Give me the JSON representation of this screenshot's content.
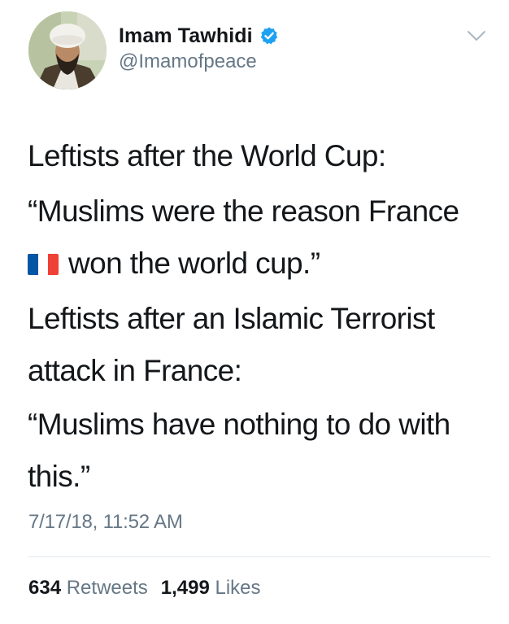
{
  "user": {
    "display_name": "Imam Tawhidi",
    "handle": "@Imamofpeace",
    "verified": true
  },
  "tweet": {
    "line1": "Leftists after the World Cup:",
    "quote1_part1": "“Muslims were the reason France",
    "quote1_part2": "won the world cup.”",
    "line3_part1": "Leftists after an Islamic Terrorist",
    "line3_part2": "attack in France:",
    "quote2_part1": "“Muslims have nothing to do with",
    "quote2_part2": "this.”",
    "flag_icon": "france-flag-icon"
  },
  "timestamp": "7/17/18, 11:52 AM",
  "stats": {
    "retweets_count": "634",
    "retweets_label": "Retweets",
    "likes_count": "1,499",
    "likes_label": "Likes"
  },
  "colors": {
    "verified_blue": "#1da1f2",
    "muted_text": "#657786",
    "main_text": "#14171a",
    "flag_blue": "#0055a4",
    "flag_white": "#ffffff",
    "flag_red": "#ef4135"
  }
}
